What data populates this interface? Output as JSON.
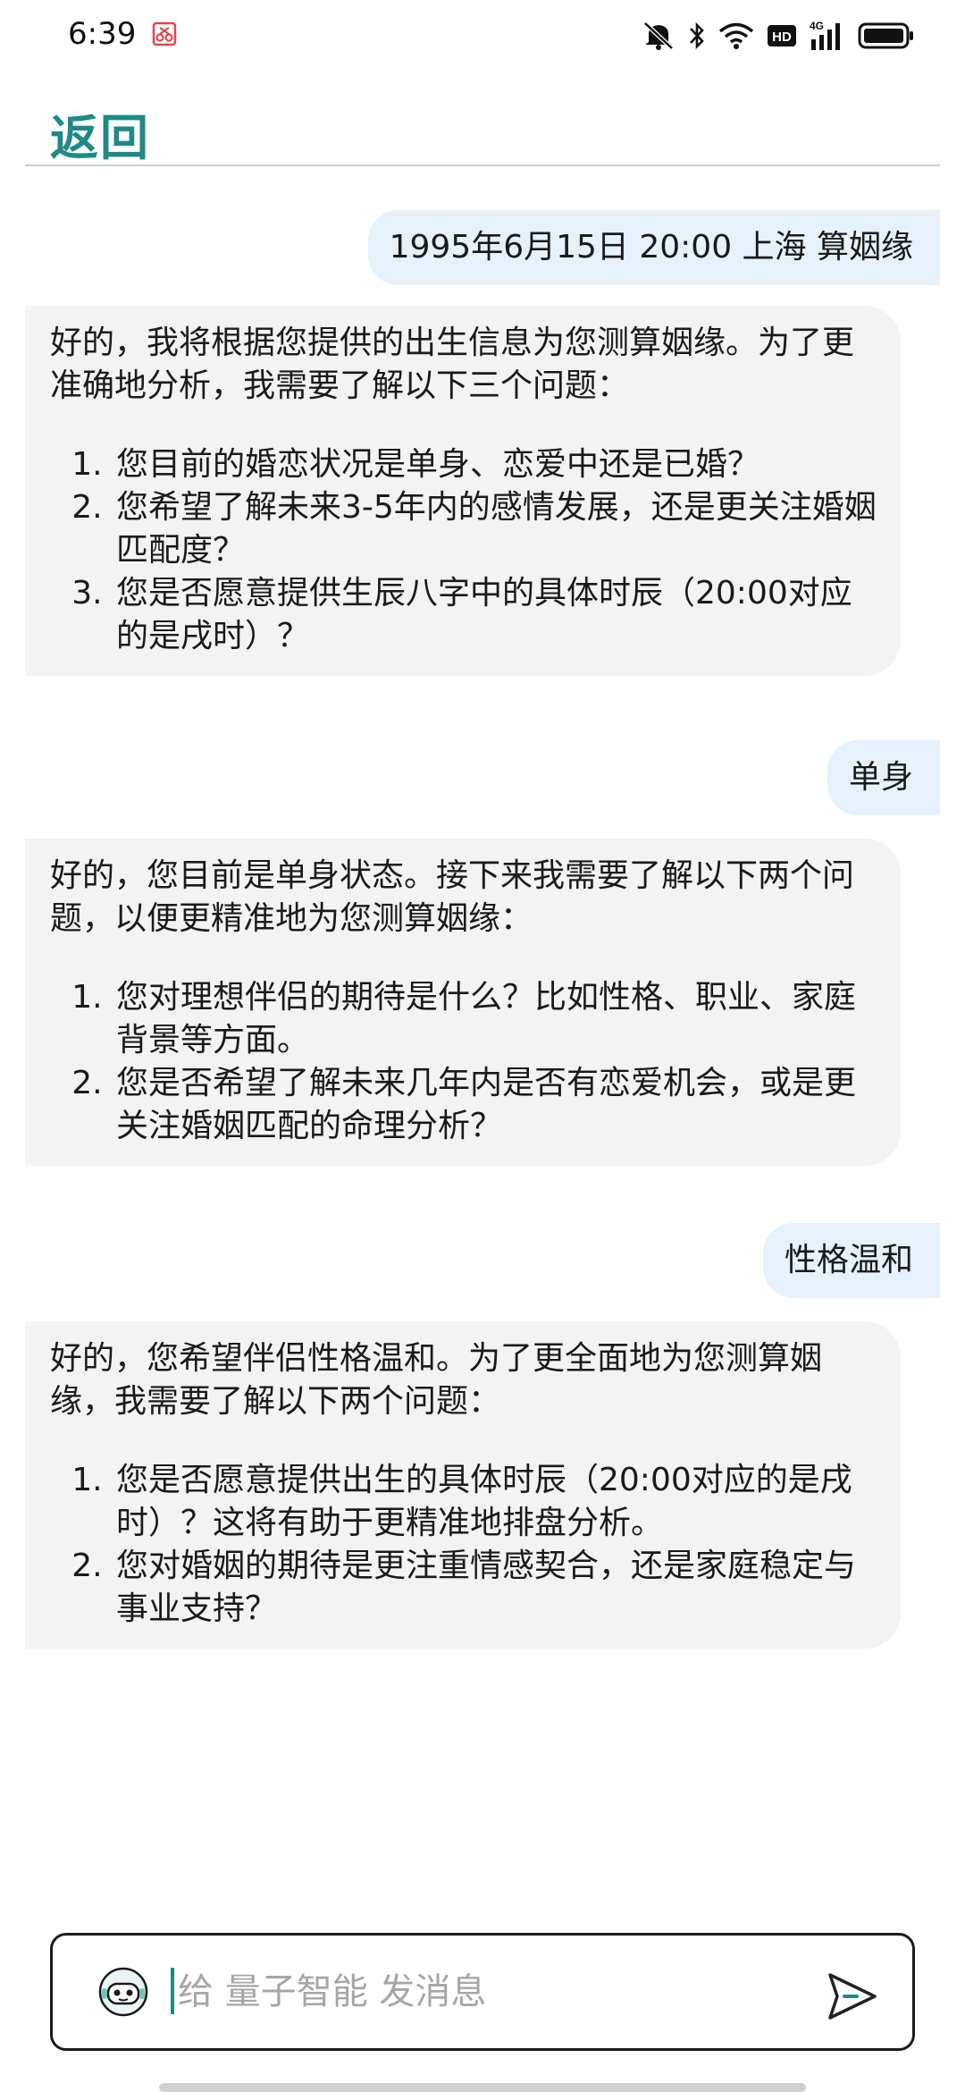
{
  "status_bar": {
    "time": "6:39",
    "network_label": "4G",
    "hd_label": "HD",
    "icons": [
      "screen-record-icon",
      "mute-icon",
      "bluetooth-icon",
      "wifi-icon",
      "hd-icon",
      "signal-icon",
      "battery-icon"
    ]
  },
  "header": {
    "back_label": "返回"
  },
  "messages": [
    {
      "role": "user",
      "text": "1995年6月15日 20:00 上海 算姻缘"
    },
    {
      "role": "assistant",
      "intro": "好的，我将根据您提供的出生信息为您测算姻缘。为了更准确地分析，我需要了解以下三个问题：",
      "items": [
        "您目前的婚恋状况是单身、恋爱中还是已婚？",
        "您希望了解未来3-5年内的感情发展，还是更关注婚姻匹配度？",
        "您是否愿意提供生辰八字中的具体时辰（20:00对应的是戌时）？"
      ]
    },
    {
      "role": "user",
      "text": "单身"
    },
    {
      "role": "assistant",
      "intro": "好的，您目前是单身状态。接下来我需要了解以下两个问题，以便更精准地为您测算姻缘：",
      "items": [
        "您对理想伴侣的期待是什么？比如性格、职业、家庭背景等方面。",
        "您是否希望了解未来几年内是否有恋爱机会，或是更关注婚姻匹配的命理分析？"
      ]
    },
    {
      "role": "user",
      "text": "性格温和"
    },
    {
      "role": "assistant",
      "intro": "好的，您希望伴侣性格温和。为了更全面地为您测算姻缘，我需要了解以下两个问题：",
      "items": [
        "您是否愿意提供出生的具体时辰（20:00对应的是戌时）？这将有助于更精准地排盘分析。",
        "您对婚姻的期待是更注重情感契合，还是家庭稳定与事业支持？"
      ]
    }
  ],
  "input": {
    "placeholder": "给 量子智能 发消息",
    "value": ""
  },
  "colors": {
    "accent": "#1f8a85",
    "user_bubble": "#e6f1fb",
    "ai_bubble": "#f3f3f3"
  }
}
